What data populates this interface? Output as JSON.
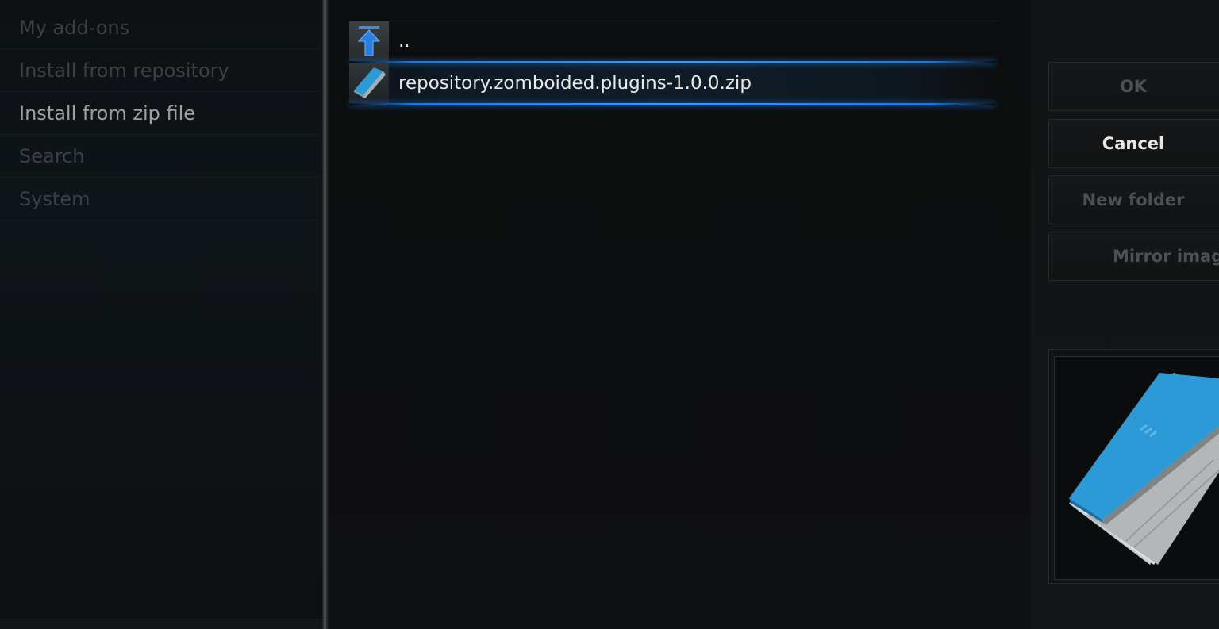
{
  "sidebar": {
    "items": [
      {
        "label": "My add-ons"
      },
      {
        "label": "Install from repository"
      },
      {
        "label": "Install from zip file"
      },
      {
        "label": "Search"
      },
      {
        "label": "System"
      }
    ],
    "active_index": 2
  },
  "filelist": {
    "parent": {
      "label": "..",
      "icon": "up-arrow-icon"
    },
    "files": [
      {
        "label": "repository.zomboided.plugins-1.0.0.zip",
        "icon": "zip-file-icon",
        "selected": true
      }
    ]
  },
  "buttons": {
    "ok": "OK",
    "cancel": "Cancel",
    "new_folder": "New folder",
    "mirror_image": "Mirror image"
  },
  "preview": {
    "icon": "zip-file-preview-icon"
  },
  "colors": {
    "accent": "#2e8fff",
    "selected_text": "#e8eaeb",
    "dim_text": "#3a4045"
  }
}
